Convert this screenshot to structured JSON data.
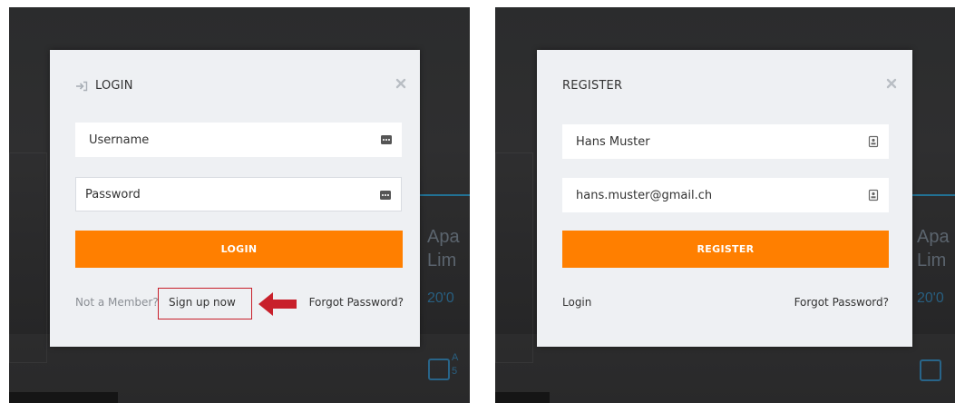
{
  "login_modal": {
    "title": "LOGIN",
    "username_placeholder": "Username",
    "password_placeholder": "Password",
    "submit_label": "LOGIN",
    "not_member_text": "Not a Member?",
    "signup_link": "Sign up now",
    "forgot_link": "Forgot Password?"
  },
  "register_modal": {
    "title": "REGISTER",
    "name_value": "Hans Muster",
    "email_value": "hans.muster@gmail.ch",
    "submit_label": "REGISTER",
    "login_link": "Login",
    "forgot_link": "Forgot Password?"
  },
  "background": {
    "listing_title_lines": [
      "Apa",
      "Lim"
    ],
    "listing_price": "20'0",
    "listing_meta_left": "A",
    "listing_meta_right": "5"
  },
  "colors": {
    "accent": "#ff7f00",
    "annotation": "#c8202b",
    "modal_bg": "#eef0f3",
    "overlay_bg": "#2b2c2d"
  },
  "icons": {
    "login_title": "sign-in-icon",
    "close": "close-icon",
    "username_field": "keyboard-icon",
    "password_field": "keyboard-icon",
    "name_field": "contact-card-icon",
    "email_field": "contact-card-icon",
    "annotation": "left-arrow-icon"
  }
}
